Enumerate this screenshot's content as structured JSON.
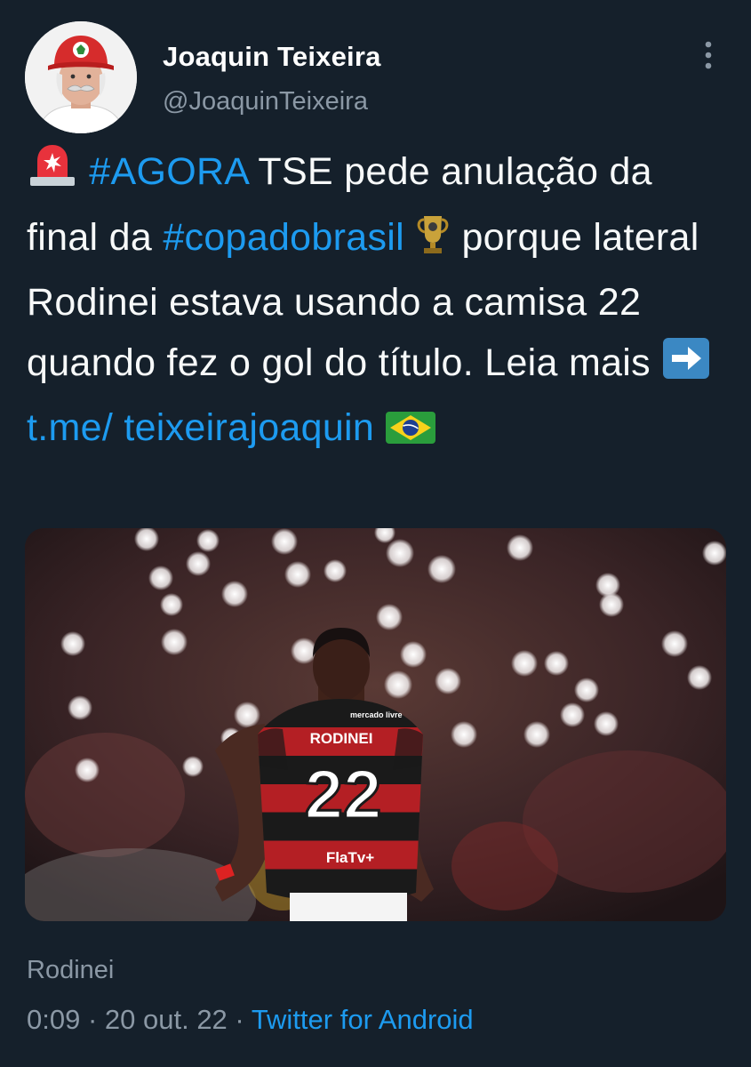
{
  "author": {
    "display_name": "Joaquin Teixeira",
    "handle": "@JoaquinTeixeira",
    "avatar_icon": "person-with-red-cap-avatar"
  },
  "menu_icon": "more-vertical-icon",
  "tweet": {
    "hashtag_agora": "#AGORA",
    "text_1": " TSE pede anulação da final da ",
    "hashtag_copa": "#copadobrasil",
    "text_2": " porque lateral Rodinei estava usando a camisa 22 quando fez o gol do título. Leia mais ",
    "link": "t.me/ teixeirajoaquin",
    "emojis": [
      "police-light-emoji",
      "trophy-emoji",
      "right-arrow-emoji",
      "brazil-flag-emoji"
    ]
  },
  "media": {
    "jersey_name": "RODINEI",
    "jersey_number": "22",
    "sponsor": "FlaTv+",
    "sponsor_top": "mercado livre"
  },
  "media_caption": "Rodinei",
  "meta": {
    "time": "0:09",
    "separator": " · ",
    "date": "20 out. 22",
    "source": "Twitter for Android"
  },
  "colors": {
    "background": "#15202b",
    "link": "#1d9bf0",
    "secondary_text": "#8b98a5"
  }
}
